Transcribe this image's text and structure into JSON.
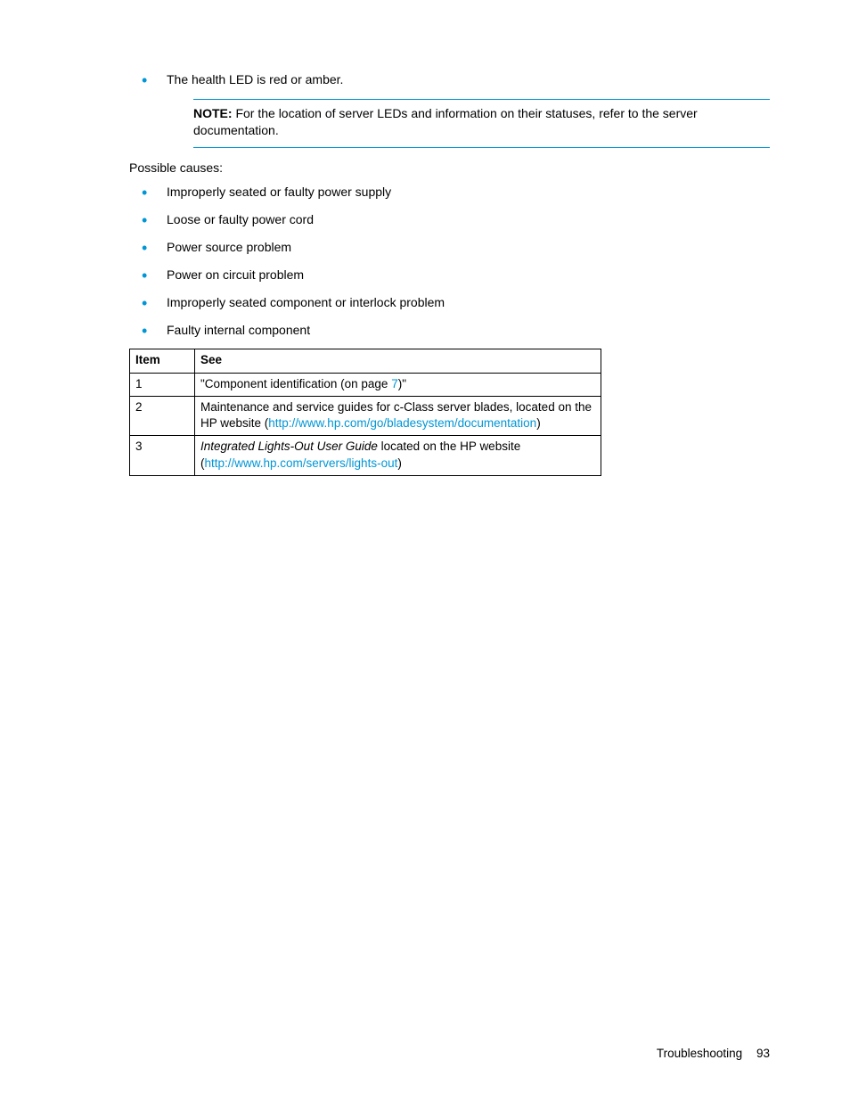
{
  "top_bullet": "The health LED is red or amber.",
  "note": {
    "label": "NOTE:",
    "text": "For the location of server LEDs and information on their statuses, refer to the server documentation."
  },
  "causes_heading": "Possible causes:",
  "causes": [
    "Improperly seated or faulty power supply",
    "Loose or faulty power cord",
    "Power source problem",
    "Power on circuit problem",
    "Improperly seated component or interlock problem",
    "Faulty internal component"
  ],
  "table": {
    "headers": {
      "item": "Item",
      "see": "See"
    },
    "rows": [
      {
        "item": "1",
        "see_pre": "\"Component identification (on page ",
        "see_link": "7",
        "see_post": ")\""
      },
      {
        "item": "2",
        "see_pre": "Maintenance and service guides for c-Class server blades, located on the HP website (",
        "see_link": "http://www.hp.com/go/bladesystem/documentation",
        "see_post": ")"
      },
      {
        "item": "3",
        "see_italic": "Integrated Lights-Out User Guide",
        "see_pre": " located on the HP website (",
        "see_link": "http://www.hp.com/servers/lights-out",
        "see_post": ")"
      }
    ]
  },
  "footer": {
    "section": "Troubleshooting",
    "page": "93"
  }
}
